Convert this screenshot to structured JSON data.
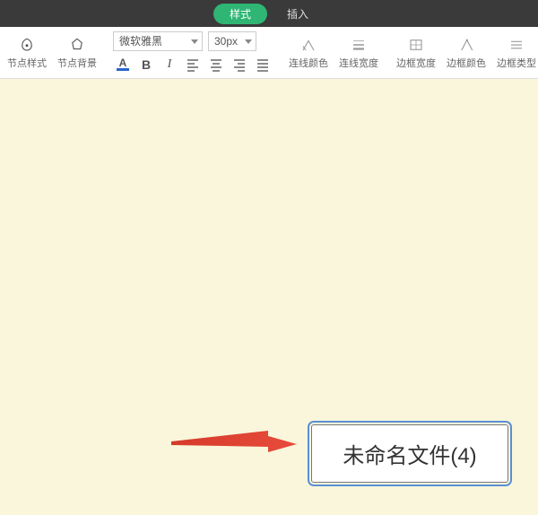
{
  "tabs": {
    "style": "样式",
    "insert": "插入"
  },
  "toolbar": {
    "node_style": "节点样式",
    "node_bg": "节点背景",
    "font_name": "微软雅黑",
    "font_size": "30px",
    "line_color": "连线颜色",
    "line_width": "连线宽度",
    "border_width": "边框宽度",
    "border_color": "边框颜色",
    "border_type": "边框类型"
  },
  "canvas": {
    "node_text": "未命名文件(4)"
  }
}
